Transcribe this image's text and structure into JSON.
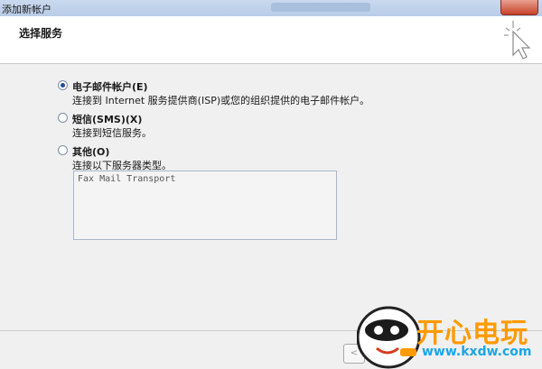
{
  "window": {
    "title": "添加新帐户"
  },
  "header": {
    "title": "选择服务"
  },
  "options": [
    {
      "label": "电子邮件帐户(E)",
      "description": "连接到 Internet 服务提供商(ISP)或您的组织提供的电子邮件帐户。",
      "selected": true
    },
    {
      "label": "短信(SMS)(X)",
      "description": "连接到短信服务。",
      "selected": false
    },
    {
      "label": "其他(O)",
      "description": "连接以下服务器类型。",
      "selected": false
    }
  ],
  "server_types": [
    "Fax Mail Transport"
  ],
  "footer": {
    "back_label": "<"
  },
  "watermark": {
    "brand": "开心电玩",
    "url": "www.kxdw.com"
  },
  "colors": {
    "accent": "#1f4e97",
    "watermark_orange": "#ff9a00",
    "watermark_blue": "#1aa6e8"
  }
}
